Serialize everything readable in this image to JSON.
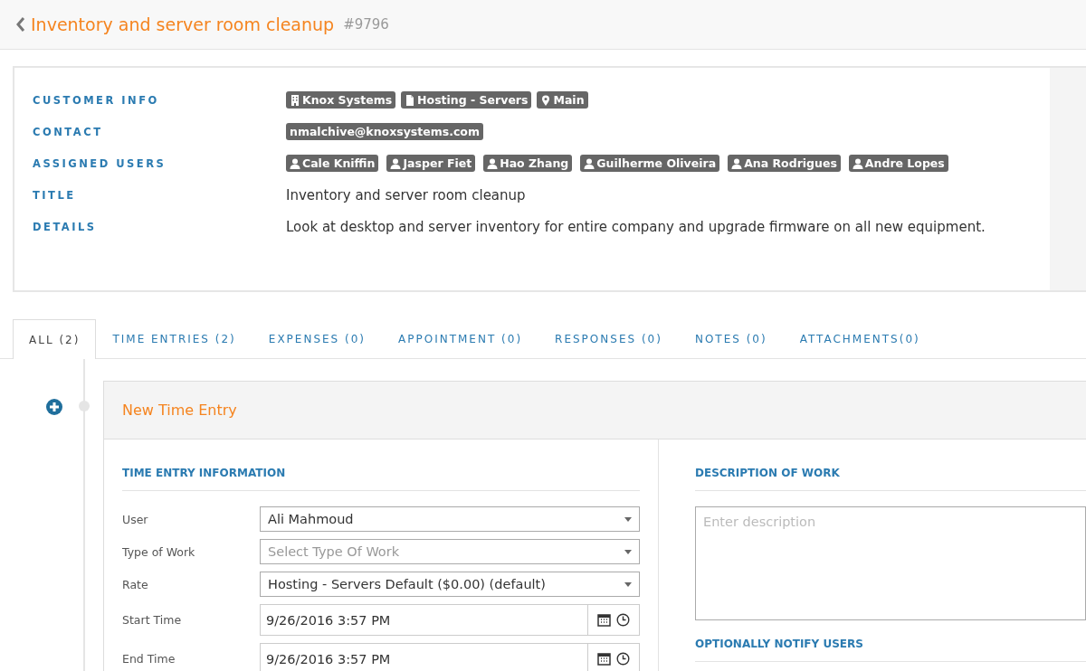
{
  "header": {
    "title": "Inventory and server room cleanup",
    "ticket_number": "#9796"
  },
  "info": [
    {
      "label": "CUSTOMER INFO",
      "kind": "tags",
      "tags": [
        {
          "text": "Knox Systems",
          "kind": "company"
        },
        {
          "text": "Hosting - Servers",
          "kind": "project"
        },
        {
          "text": "Main",
          "kind": "location"
        }
      ]
    },
    {
      "label": "CONTACT",
      "kind": "tags",
      "tags": [
        {
          "text": "nmalchive@knoxsystems.com",
          "kind": "email"
        }
      ]
    },
    {
      "label": "ASSIGNED USERS",
      "kind": "users",
      "tags": [
        {
          "text": "Cale Kniffin",
          "kind": "user"
        },
        {
          "text": "Jasper Fiet",
          "kind": "user"
        },
        {
          "text": "Hao Zhang",
          "kind": "user"
        },
        {
          "text": "Guilherme Oliveira",
          "kind": "user"
        },
        {
          "text": "Ana Rodrigues",
          "kind": "user"
        },
        {
          "text": "Andre Lopes",
          "kind": "user"
        }
      ]
    },
    {
      "label": "TITLE",
      "kind": "text",
      "text": "Inventory and server room cleanup"
    },
    {
      "label": "DETAILS",
      "kind": "text",
      "text": "Look at desktop and server inventory for entire company and upgrade firmware on all new equipment."
    }
  ],
  "tabs": [
    {
      "label": "ALL (2)",
      "selected": true
    },
    {
      "label": "TIME ENTRIES (2)",
      "selected": false
    },
    {
      "label": "EXPENSES (0)",
      "selected": false
    },
    {
      "label": "APPOINTMENT (0)",
      "selected": false
    },
    {
      "label": "RESPONSES (0)",
      "selected": false
    },
    {
      "label": "NOTES (0)",
      "selected": false
    },
    {
      "label": "ATTACHMENTS(0)",
      "selected": false
    }
  ],
  "panel": {
    "title": "New Time Entry",
    "left_heading": "TIME ENTRY INFORMATION",
    "fields": [
      {
        "label": "User",
        "kind": "select",
        "value": "Ali Mahmoud"
      },
      {
        "label": "Type of Work",
        "kind": "select",
        "placeholder": "Select Type Of Work"
      },
      {
        "label": "Rate",
        "kind": "select",
        "value": "Hosting - Servers Default ($0.00) (default)"
      },
      {
        "label": "Start Time",
        "kind": "datetime",
        "value": "9/26/2016 3:57 PM"
      },
      {
        "label": "End Time",
        "kind": "datetime",
        "value": "9/26/2016 3:57 PM"
      }
    ],
    "right_heading": "DESCRIPTION OF WORK",
    "description": {
      "placeholder": "Enter description"
    },
    "notify_heading": "OPTIONALLY NOTIFY USERS"
  }
}
